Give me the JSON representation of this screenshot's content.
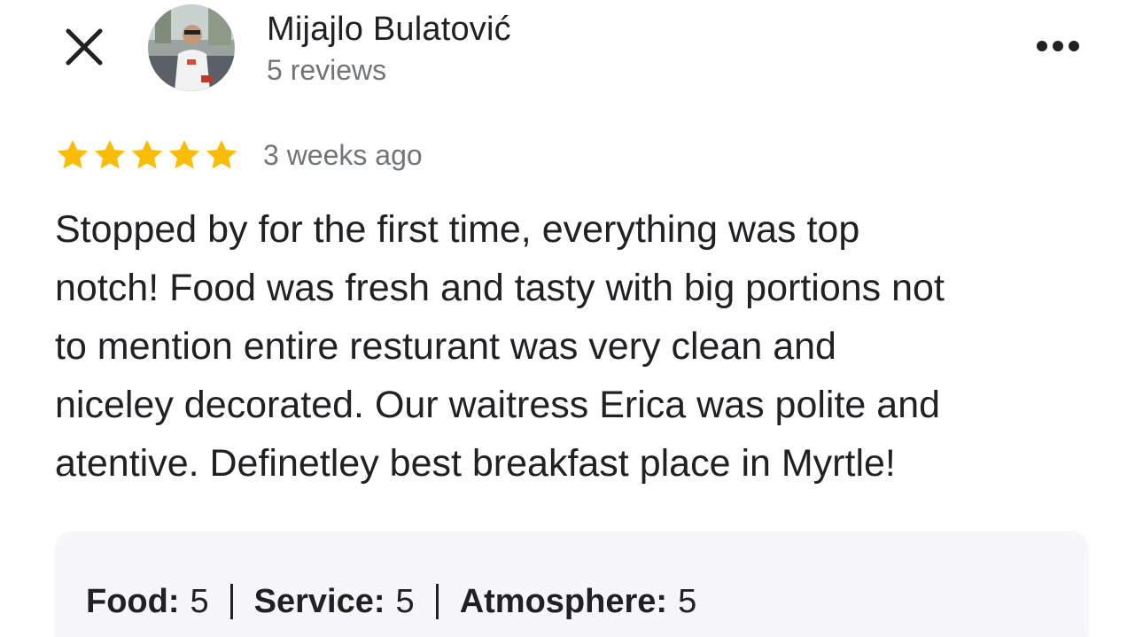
{
  "header": {
    "close_icon": "close-icon",
    "reviewer_name": "Mijajlo Bulatović",
    "review_count": "5 reviews",
    "more_icon": "more-horizontal-icon"
  },
  "review": {
    "rating": 5,
    "max_rating": 5,
    "star_color": "#fbbc04",
    "time_ago": "3 weeks ago",
    "lines": [
      "Stopped by for the first time, everything was top",
      "notch! Food was fresh and tasty with big portions not",
      "to mention entire resturant was very clean and",
      "niceley decorated. Our waitress Erica was polite and",
      "atentive. Definetley best breakfast place in Myrtle!"
    ]
  },
  "attributes": [
    {
      "label": "Food:",
      "value": "5"
    },
    {
      "label": "Service:",
      "value": "5"
    },
    {
      "label": "Atmosphere:",
      "value": "5"
    }
  ]
}
